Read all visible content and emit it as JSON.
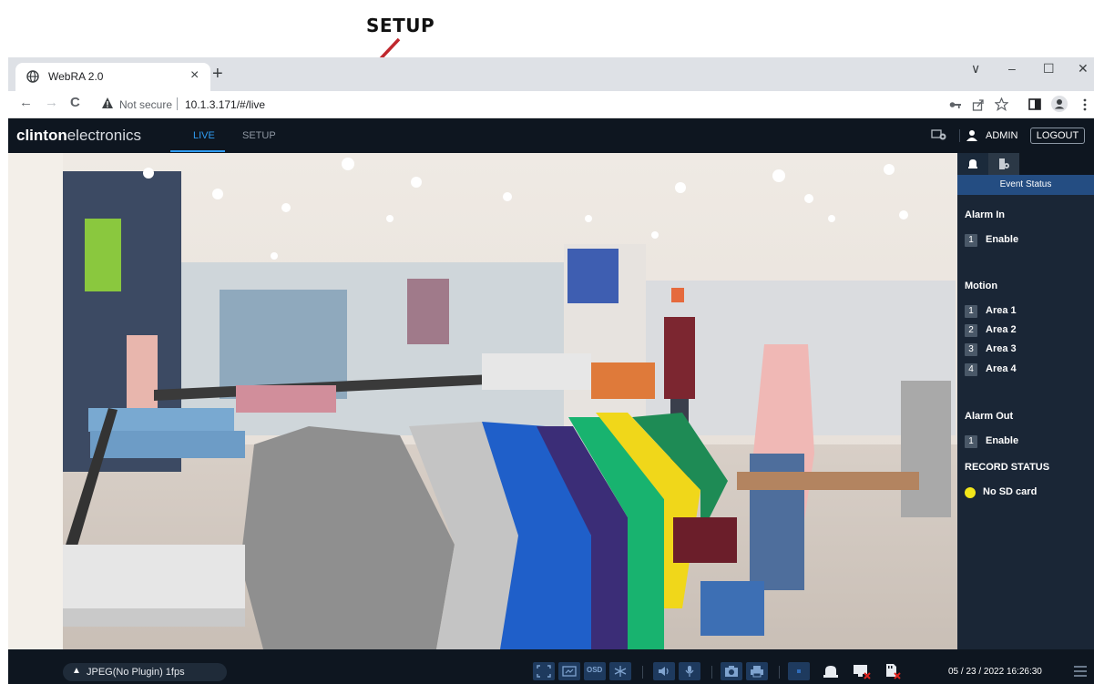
{
  "annotation": {
    "label": "SETUP"
  },
  "browser": {
    "tab_title": "WebRA 2.0",
    "tab_close": "×",
    "new_tab": "+",
    "window_controls": [
      "∨",
      "–",
      "☐",
      "✕"
    ],
    "nav": {
      "back": "←",
      "forward": "→",
      "reload": "C"
    },
    "security_text": "Not secure",
    "url": "10.1.3.171/#/live"
  },
  "app": {
    "brand_bold": "clinton",
    "brand_rest": "electronics",
    "nav": {
      "live": "LIVE",
      "setup": "SETUP"
    },
    "user": "ADMIN",
    "logout": "LOGOUT"
  },
  "side_panel": {
    "header": "Event Status",
    "alarm_in": {
      "title": "Alarm In",
      "items": [
        {
          "num": "1",
          "label": "Enable"
        }
      ]
    },
    "motion": {
      "title": "Motion",
      "items": [
        {
          "num": "1",
          "label": "Area 1"
        },
        {
          "num": "2",
          "label": "Area 2"
        },
        {
          "num": "3",
          "label": "Area 3"
        },
        {
          "num": "4",
          "label": "Area 4"
        }
      ]
    },
    "alarm_out": {
      "title": "Alarm Out",
      "items": [
        {
          "num": "1",
          "label": "Enable"
        }
      ]
    },
    "record_status": {
      "title": "RECORD STATUS",
      "value": "No SD card",
      "color": "#f3e61a"
    }
  },
  "bottom": {
    "stream_caret": "▲",
    "stream": "JPEG(No Plugin) 1fps",
    "datetime": "05 / 23 / 2022 16:26:30",
    "buttons": [
      "fullscreen-icon",
      "fit-icon",
      "osd-icon",
      "freeze-icon",
      "audio-icon",
      "mic-icon",
      "snapshot-icon",
      "print-icon",
      "record-icon",
      "alarm-icon",
      "display-off-icon",
      "sd-off-icon"
    ],
    "osd_label": "OSD"
  },
  "colors": {
    "accent": "#2f9bf0",
    "annotation": "#c0282e",
    "panel_header": "#244d82"
  }
}
